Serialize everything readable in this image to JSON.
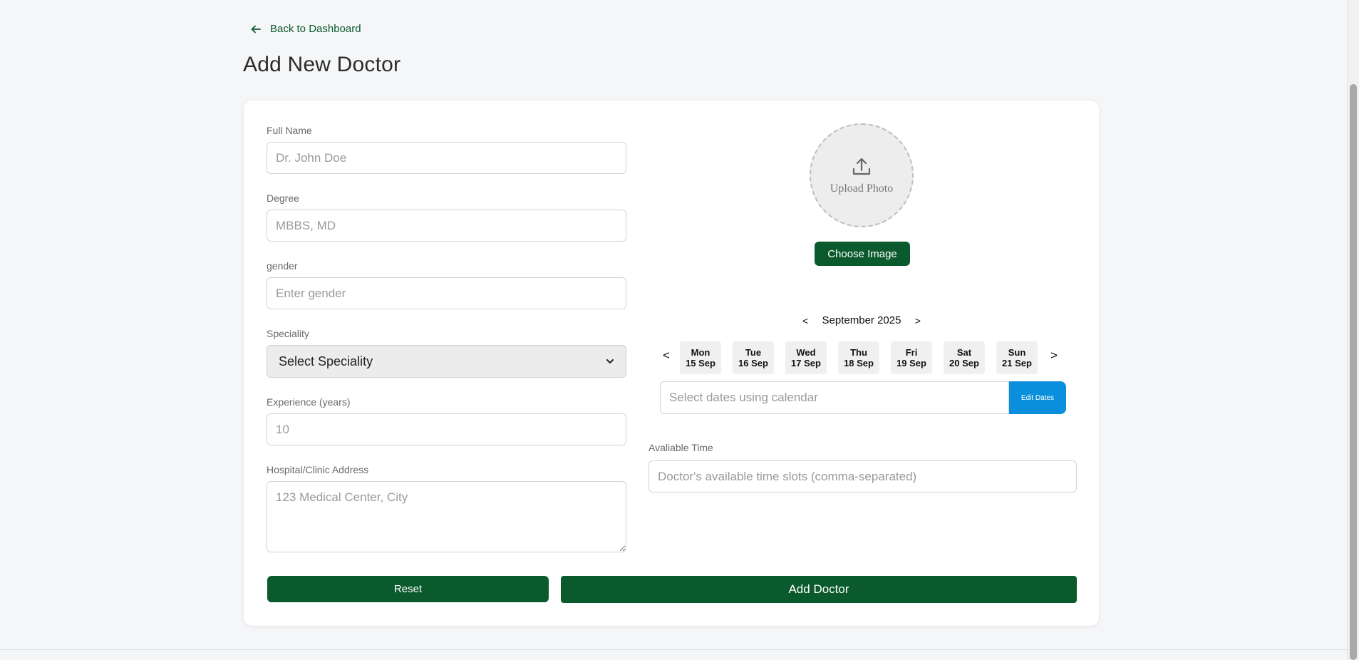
{
  "header": {
    "back_label": "Back to Dashboard",
    "title": "Add New Doctor"
  },
  "form": {
    "full_name": {
      "label": "Full Name",
      "placeholder": "Dr. John Doe"
    },
    "degree": {
      "label": "Degree",
      "placeholder": "MBBS, MD"
    },
    "gender": {
      "label": "gender",
      "placeholder": "Enter gender"
    },
    "speciality": {
      "label": "Speciality",
      "selected": "Select Speciality"
    },
    "experience": {
      "label": "Experience (years)",
      "placeholder": "10"
    },
    "address": {
      "label": "Hospital/Clinic Address",
      "placeholder": "123 Medical Center, City"
    }
  },
  "photo": {
    "upload_label": "Upload Photo",
    "choose_button": "Choose Image"
  },
  "calendar": {
    "month": "September 2025",
    "prev_month": "<",
    "next_month": ">",
    "prev_week": "<",
    "next_week": ">",
    "days": [
      {
        "weekday": "Mon",
        "date": "15 Sep"
      },
      {
        "weekday": "Tue",
        "date": "16 Sep"
      },
      {
        "weekday": "Wed",
        "date": "17 Sep"
      },
      {
        "weekday": "Thu",
        "date": "18 Sep"
      },
      {
        "weekday": "Fri",
        "date": "19 Sep"
      },
      {
        "weekday": "Sat",
        "date": "20 Sep"
      },
      {
        "weekday": "Sun",
        "date": "21 Sep"
      }
    ],
    "dates_placeholder": "Select dates using calendar",
    "edit_button": "Edit Dates"
  },
  "time": {
    "label": "Avaliable Time",
    "placeholder": "Doctor's available time slots (comma-separated)"
  },
  "actions": {
    "reset": "Reset",
    "submit": "Add Doctor"
  },
  "colors": {
    "primary_green": "#0b5a2e",
    "edit_blue": "#0a8fdc",
    "background": "#f5f6f8"
  }
}
